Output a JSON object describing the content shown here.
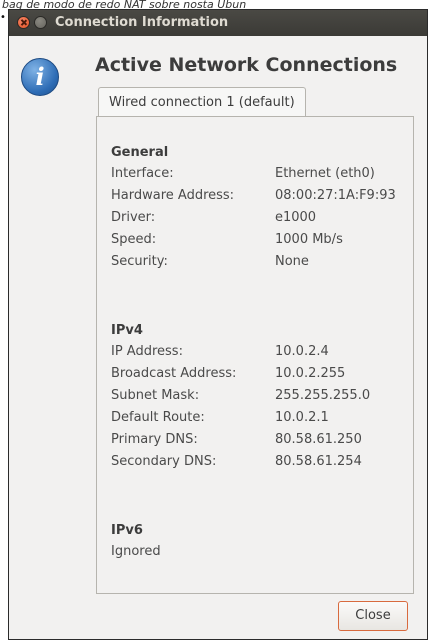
{
  "caption": "bag de modo de redo NAT sobre nosta Ubun",
  "window": {
    "title": "Connection Information"
  },
  "header": {
    "icon": "info-icon",
    "heading": "Active Network Connections"
  },
  "tab": {
    "label": "Wired connection 1 (default)"
  },
  "general": {
    "title": "General",
    "rows": [
      {
        "key": "Interface:",
        "value": "Ethernet (eth0)"
      },
      {
        "key": "Hardware Address:",
        "value": "08:00:27:1A:F9:93"
      },
      {
        "key": "Driver:",
        "value": "e1000"
      },
      {
        "key": "Speed:",
        "value": "1000 Mb/s"
      },
      {
        "key": "Security:",
        "value": "None"
      }
    ]
  },
  "ipv4": {
    "title": "IPv4",
    "rows": [
      {
        "key": "IP Address:",
        "value": "10.0.2.4"
      },
      {
        "key": "Broadcast Address:",
        "value": "10.0.2.255"
      },
      {
        "key": "Subnet Mask:",
        "value": "255.255.255.0"
      },
      {
        "key": "Default Route:",
        "value": "10.0.2.1"
      },
      {
        "key": "Primary DNS:",
        "value": "80.58.61.250"
      },
      {
        "key": "Secondary DNS:",
        "value": "80.58.61.254"
      }
    ]
  },
  "ipv6": {
    "title": "IPv6",
    "status": "Ignored"
  },
  "buttons": {
    "close": "Close"
  }
}
